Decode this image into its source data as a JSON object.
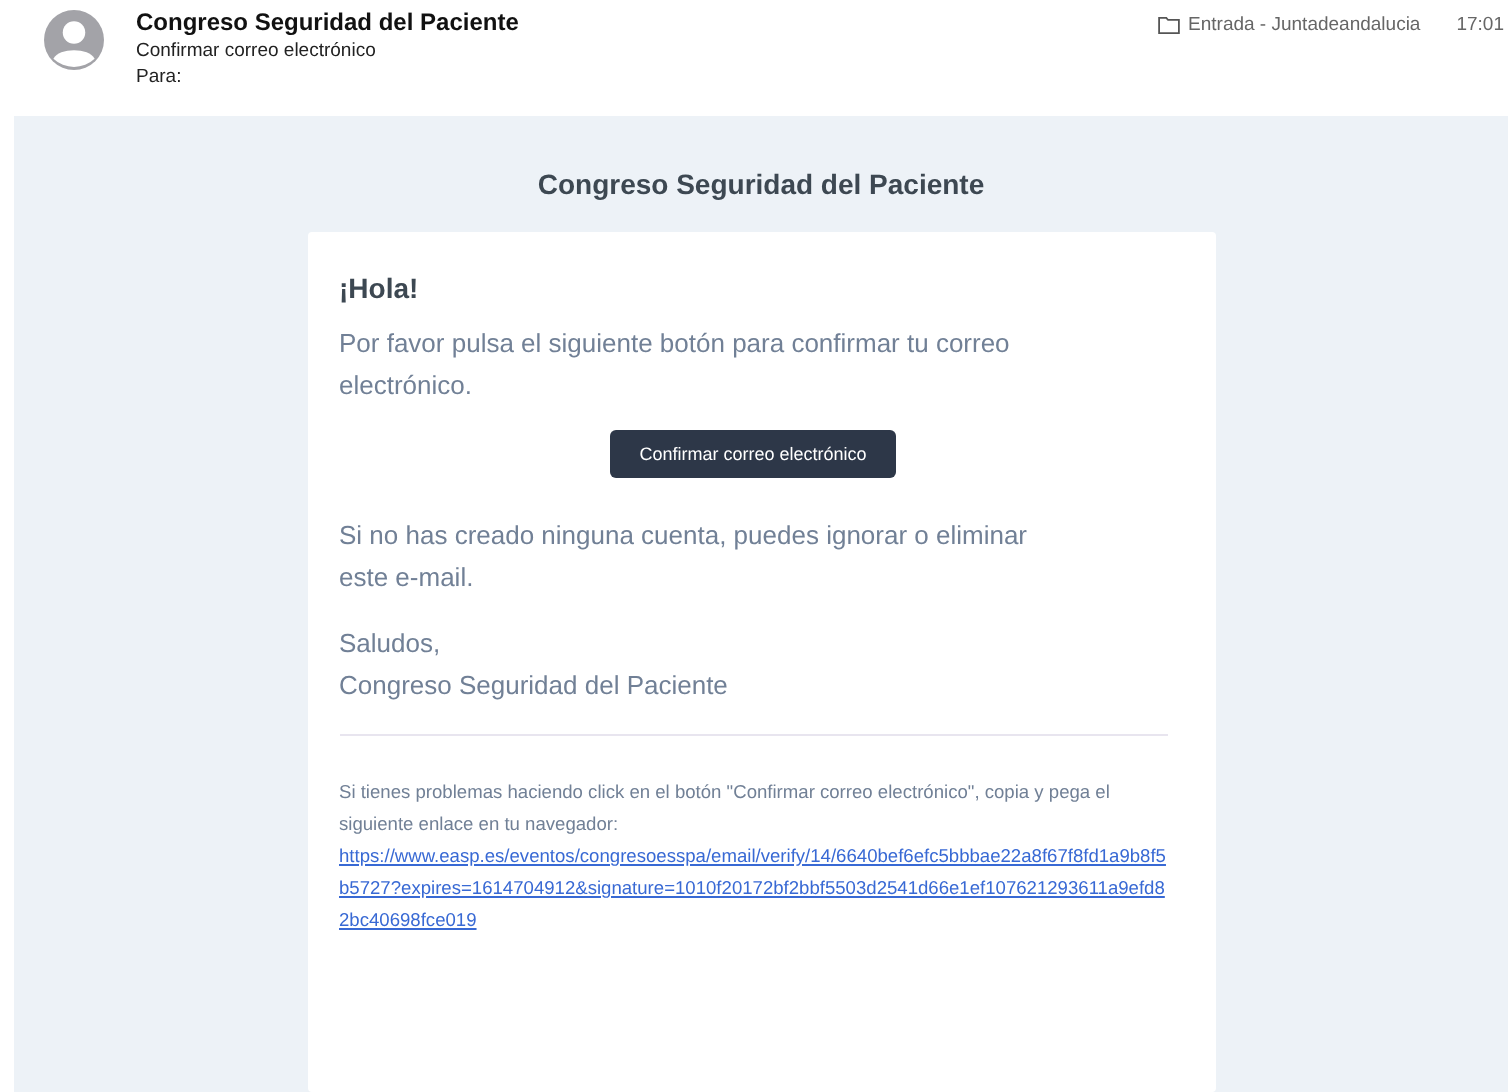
{
  "header": {
    "sender": "Congreso Seguridad del Paciente",
    "subject": "Confirmar correo electrónico",
    "to_label": "Para:",
    "folder": "Entrada - Juntadeandalucia",
    "time": "17:01"
  },
  "email": {
    "brand": "Congreso Seguridad del Paciente",
    "greeting": "¡Hola!",
    "intro": "Por favor pulsa el siguiente botón para confirmar tu correo electrónico.",
    "button": "Confirmar correo electrónico",
    "outro": "Si no has creado ninguna cuenta, puedes ignorar o eliminar este e-mail.",
    "salutation": "Saludos,",
    "signature": "Congreso Seguridad del Paciente",
    "subcopy": "Si tienes problemas haciendo click en el botón \"Confirmar correo electrónico\", copia y pega el siguiente enlace en tu navegador:",
    "link": "https://www.easp.es/eventos/congresoesspa/email/verify/14/6640bef6efc5bbbae22a8f67f8fd1a9b8f5b5727?expires=1614704912&signature=1010f20172bf2bbf5503d2541d66e1ef107621293611a9efd82bc40698fce019"
  }
}
